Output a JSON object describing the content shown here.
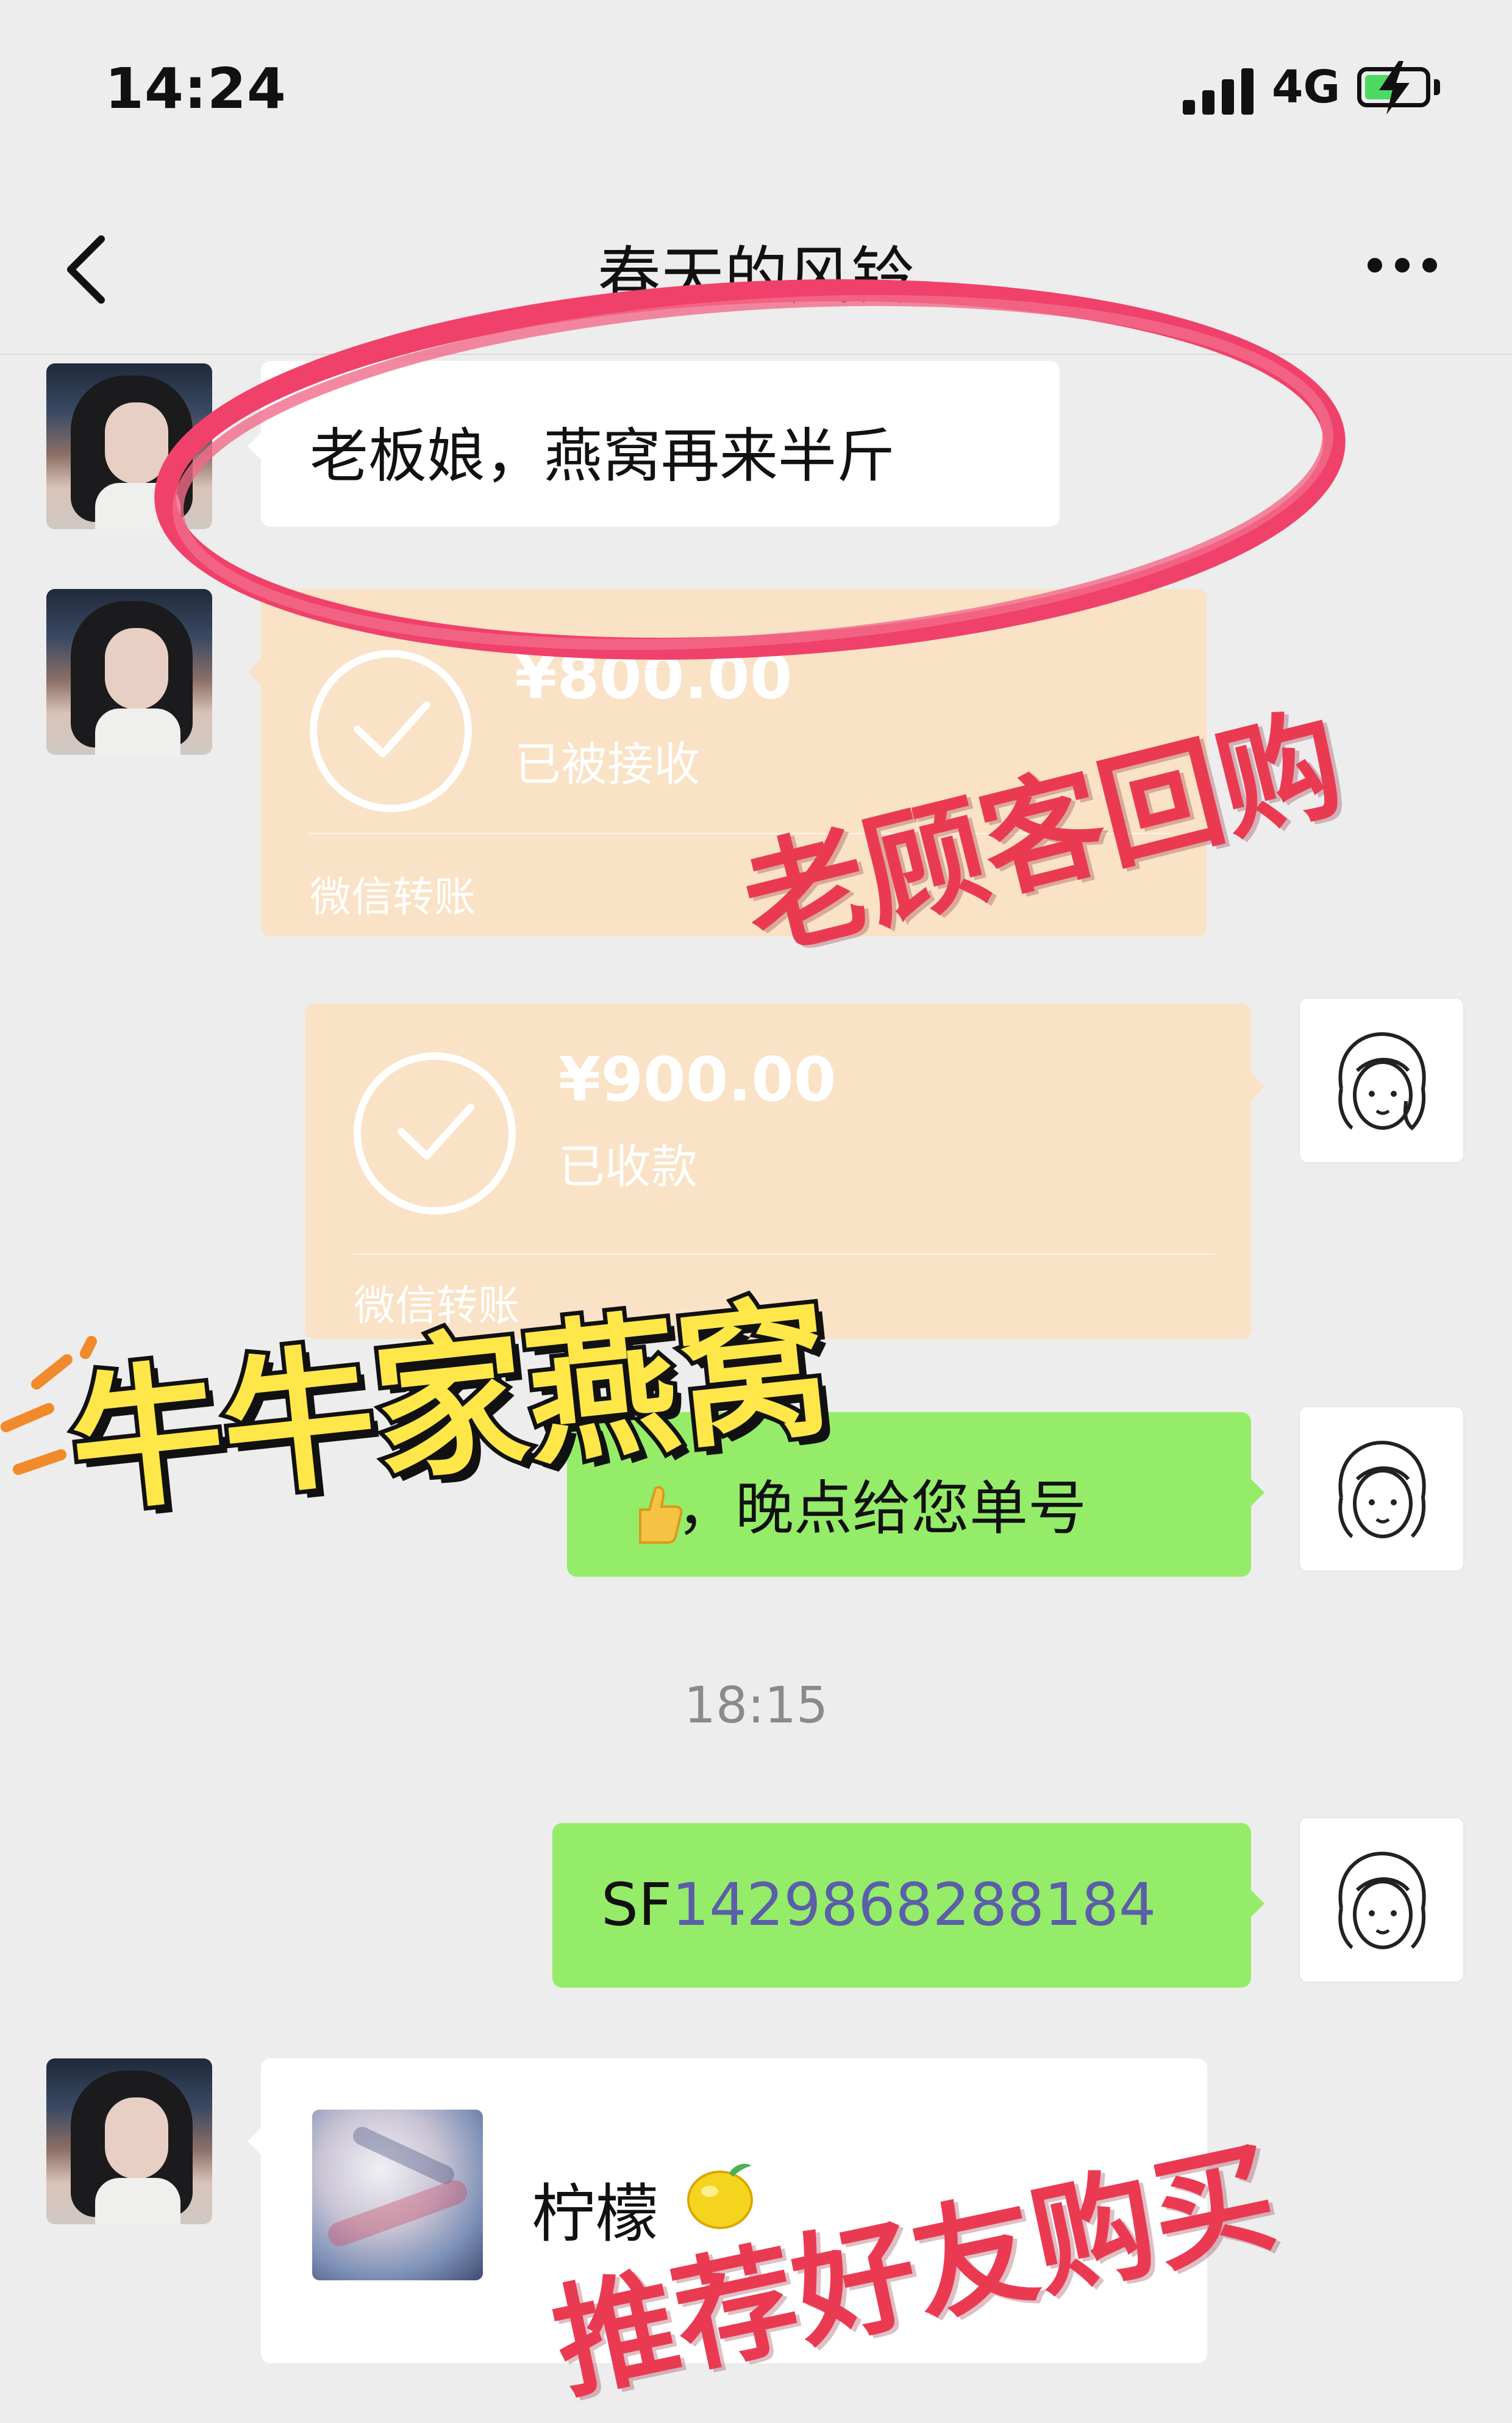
{
  "status_bar": {
    "time": "14:24",
    "network": "4G",
    "battery_level": 0.55,
    "signal_bars": 4
  },
  "nav": {
    "title": "春天的风铃",
    "back_icon": "chevron-left-icon",
    "more_icon": "more-dots-icon"
  },
  "messages": [
    {
      "side": "left",
      "type": "text",
      "text": "老板娘，燕窝再来半斤"
    },
    {
      "side": "left",
      "type": "transfer",
      "amount": "¥800.00",
      "status": "已被接收",
      "footer": "微信转账"
    },
    {
      "side": "right",
      "type": "transfer",
      "amount": "¥900.00",
      "status": "已收款",
      "footer": "微信转账"
    },
    {
      "side": "right",
      "type": "text",
      "text": "，晚点给您单号"
    },
    {
      "side": "center",
      "type": "time",
      "text": "18:15"
    },
    {
      "side": "right",
      "type": "text",
      "prefix": "SF",
      "number": "1429868288184"
    },
    {
      "side": "left",
      "type": "contact_card",
      "name": "柠檬"
    }
  ],
  "overlays": {
    "repurchase_stamp": "老顾客回购",
    "brand_sticker": "牛牛家燕窝",
    "referral_stamp": "推荐好友购买"
  },
  "colors": {
    "background": "#ededed",
    "green_bubble": "#95ec69",
    "transfer_bubble": "#f9e2c6",
    "tracking_number": "#5a5fa8",
    "stamp_red": "#ea3a52",
    "sticker_yellow": "#ffe74a"
  }
}
